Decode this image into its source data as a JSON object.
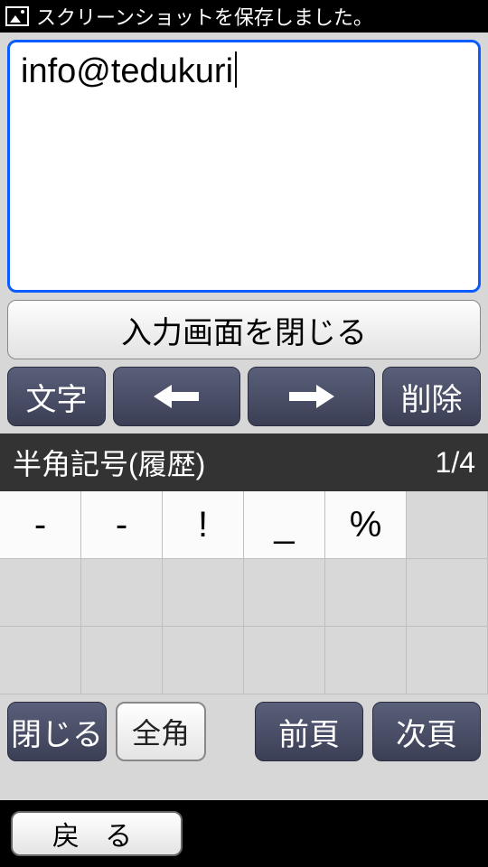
{
  "status_bar": {
    "text": "スクリーンショットを保存しました。"
  },
  "input": {
    "value": "info@tedukuri"
  },
  "buttons": {
    "close_input": "入力画面を閉じる",
    "char_mode": "文字",
    "delete": "削除",
    "close": "閉じる",
    "fullwidth": "全角",
    "prev_page": "前頁",
    "next_page": "次頁",
    "back": "戻 る"
  },
  "mode": {
    "label": "半角記号(履歴)",
    "page": "1/4"
  },
  "symbols": [
    "‑",
    "-",
    "!",
    "_",
    "%",
    ""
  ]
}
